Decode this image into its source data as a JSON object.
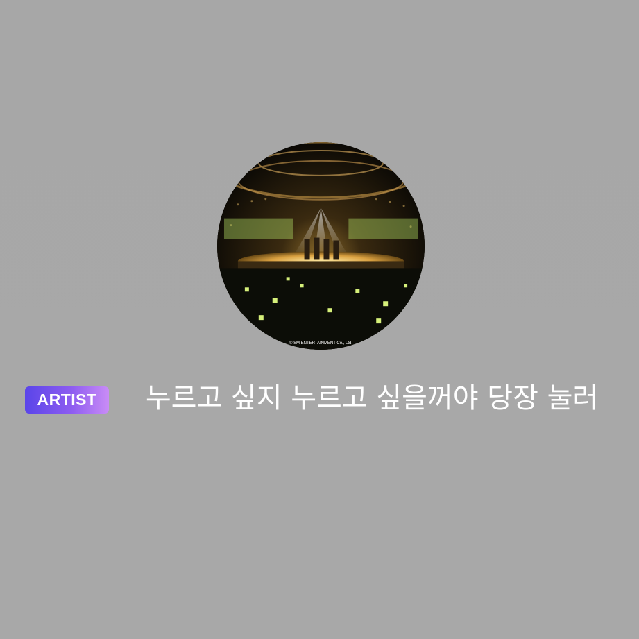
{
  "profile": {
    "avatar_icon": "concert-stage-photo",
    "watermark": "© SM ENTERTAINMENT Co., Ltd."
  },
  "badge": {
    "label": "ARTIST",
    "colors": [
      "#5a45e9",
      "#8d5cf0",
      "#c98cf6"
    ]
  },
  "caption": {
    "text": "누르고 싶지 누르고 싶을꺼야 당장 눌러"
  }
}
